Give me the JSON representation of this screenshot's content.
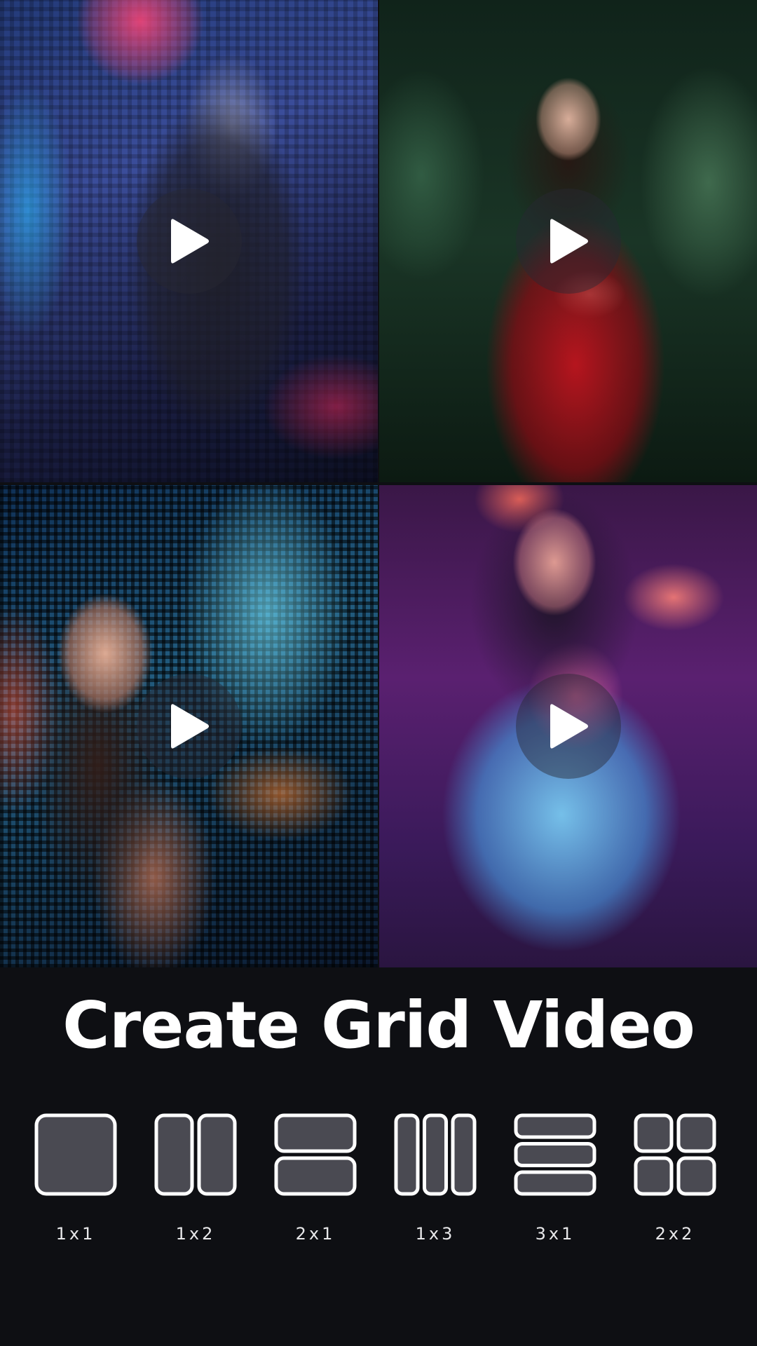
{
  "title": "Create Grid Video",
  "videos": [
    {
      "icon": "play-icon"
    },
    {
      "icon": "play-icon"
    },
    {
      "icon": "play-icon"
    },
    {
      "icon": "play-icon"
    }
  ],
  "layouts": [
    {
      "label": "1x1",
      "icon": "layout-1x1-icon"
    },
    {
      "label": "1x2",
      "icon": "layout-1x2-icon"
    },
    {
      "label": "2x1",
      "icon": "layout-2x1-icon"
    },
    {
      "label": "1x3",
      "icon": "layout-1x3-icon"
    },
    {
      "label": "3x1",
      "icon": "layout-3x1-icon"
    },
    {
      "label": "2x2",
      "icon": "layout-2x2-icon"
    }
  ],
  "colors": {
    "background": "#0e0f13",
    "icon_fill": "#4a4a52",
    "icon_stroke": "#ffffff",
    "text": "#ffffff"
  }
}
